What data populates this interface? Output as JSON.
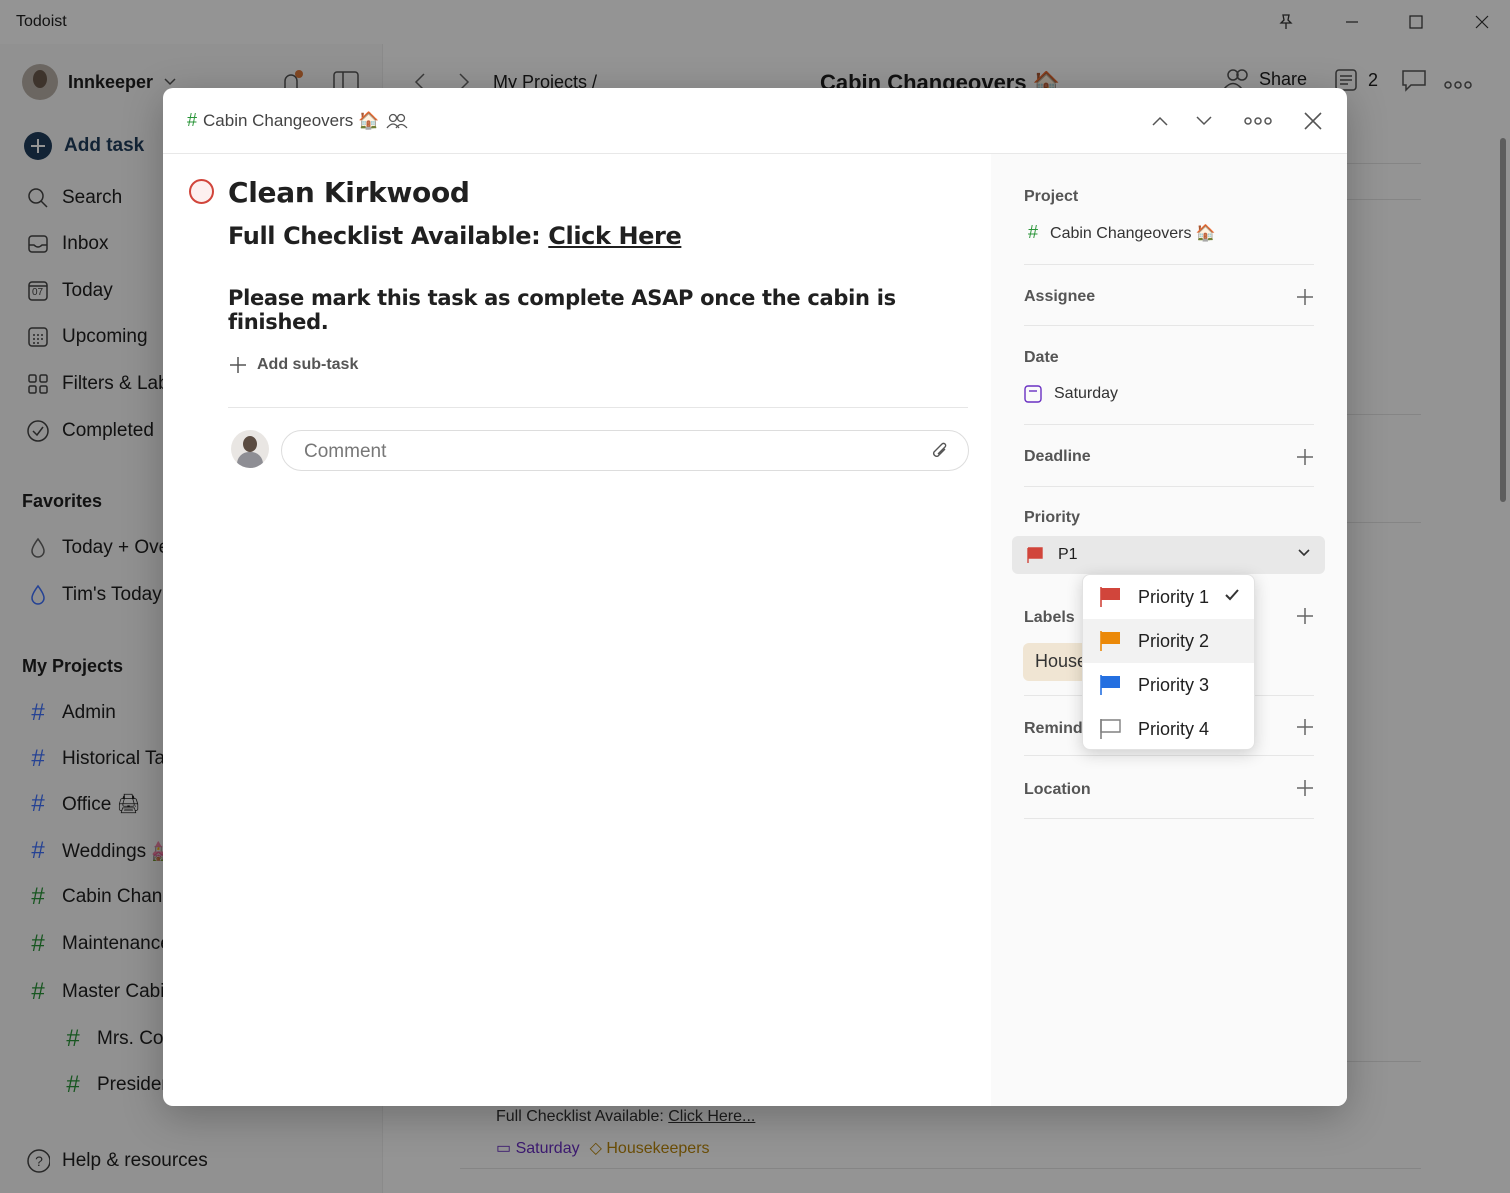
{
  "window": {
    "title": "Todoist"
  },
  "sidebar": {
    "user_name": "Innkeeper",
    "add_task": "Add task",
    "nav": [
      {
        "label": "Search",
        "icon": "search-icon"
      },
      {
        "label": "Inbox",
        "icon": "inbox-icon"
      },
      {
        "label": "Today",
        "icon": "calendar-today-icon",
        "day": "07"
      },
      {
        "label": "Upcoming",
        "icon": "calendar-grid-icon"
      },
      {
        "label": "Filters & Labels",
        "icon": "filters-icon"
      },
      {
        "label": "Completed",
        "icon": "check-circle-icon"
      }
    ],
    "favorites_title": "Favorites",
    "favorites": [
      {
        "label": "Today + Overdue"
      },
      {
        "label": "Tim's Today"
      }
    ],
    "projects_title": "My Projects",
    "projects": [
      {
        "label": "Admin",
        "color": "#4073ff"
      },
      {
        "label": "Historical Tasks",
        "color": "#4073ff"
      },
      {
        "label": "Office 🖨",
        "color": "#4073ff"
      },
      {
        "label": "Weddings 💒",
        "color": "#4073ff"
      },
      {
        "label": "Cabin Changeovers",
        "color": "#299438"
      },
      {
        "label": "Maintenance",
        "color": "#299438"
      },
      {
        "label": "Master Cabin",
        "color": "#299438"
      },
      {
        "label": "Mrs. Cook",
        "color": "#299438"
      },
      {
        "label": "President",
        "color": "#299438"
      }
    ],
    "help": "Help & resources"
  },
  "main": {
    "breadcrumb": "My Projects /",
    "title": "Cabin Changeovers 🏠",
    "share": "Share",
    "comment_count": "2",
    "bg_task_desc_prefix": "Full Checklist Available: ",
    "bg_task_desc_link": "Click Here...",
    "bg_task_date": "Saturday",
    "bg_task_label": "Housekeepers"
  },
  "modal": {
    "project_name": "Cabin Changeovers 🏠",
    "task_title": "Clean Kirkwood",
    "desc_prefix": "Full Checklist Available: ",
    "desc_link": "Click Here",
    "desc_line2": "Please mark this task as complete ASAP once the cabin is finished.",
    "add_subtask": "Add sub-task",
    "comment_placeholder": "Comment",
    "fields": {
      "project_label": "Project",
      "project_value": "Cabin Changeovers 🏠",
      "assignee_label": "Assignee",
      "date_label": "Date",
      "date_value": "Saturday",
      "deadline_label": "Deadline",
      "priority_label": "Priority",
      "priority_value": "P1",
      "labels_label": "Labels",
      "label_chip": "Housekeepers",
      "reminders_label": "Reminders",
      "location_label": "Location"
    }
  },
  "priority_menu": {
    "items": [
      {
        "label": "Priority 1",
        "color": "#d1453b",
        "selected": true
      },
      {
        "label": "Priority 2",
        "color": "#eb8909",
        "selected": false
      },
      {
        "label": "Priority 3",
        "color": "#246fe0",
        "selected": false
      },
      {
        "label": "Priority 4",
        "color": "#808080",
        "selected": false
      }
    ]
  },
  "colors": {
    "accent_red": "#d1453b",
    "project_green": "#299438",
    "project_blue": "#4073ff",
    "date_purple": "#692fc2"
  }
}
